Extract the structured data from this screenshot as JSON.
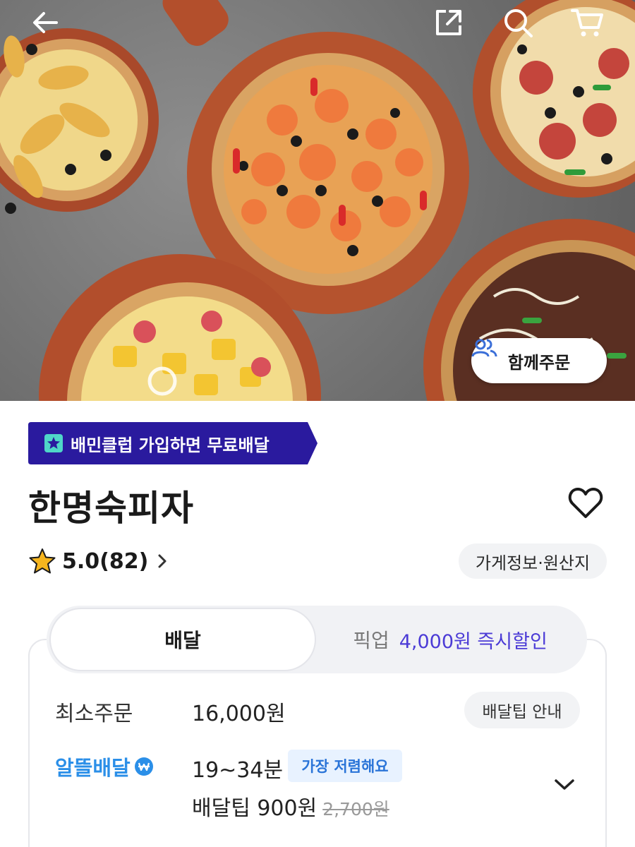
{
  "store": {
    "name": "한명숙피자",
    "rating": "5.0(82)",
    "info_label": "가게정보·원산지"
  },
  "header": {
    "group_order_label": "함께주문"
  },
  "promo": {
    "club_badge": "배민클럽 가입하면 무료배달"
  },
  "tabs": {
    "delivery": "배달",
    "pickup": "픽업",
    "pickup_discount": "4,000원 즉시할인"
  },
  "delivery": {
    "min_order_label": "최소주문",
    "min_order_value": "16,000원",
    "tip_info_label": "배달팁 안내",
    "service_name": "알뜰배달",
    "time": "19~34분",
    "cheapest_badge": "가장 저렴해요",
    "tip_label": "배달팁 900원",
    "tip_original": "2,700원"
  },
  "colors": {
    "club_purple": "#2a1a9e",
    "discount_purple": "#4b3bd6",
    "saver_blue": "#2b8fe8"
  },
  "icons": [
    "back-arrow-icon",
    "share-icon",
    "search-icon",
    "cart-icon",
    "group-people-icon",
    "heart-icon",
    "star-icon",
    "chevron-right-icon",
    "chevron-down-icon",
    "club-star-icon",
    "won-coin-icon"
  ]
}
